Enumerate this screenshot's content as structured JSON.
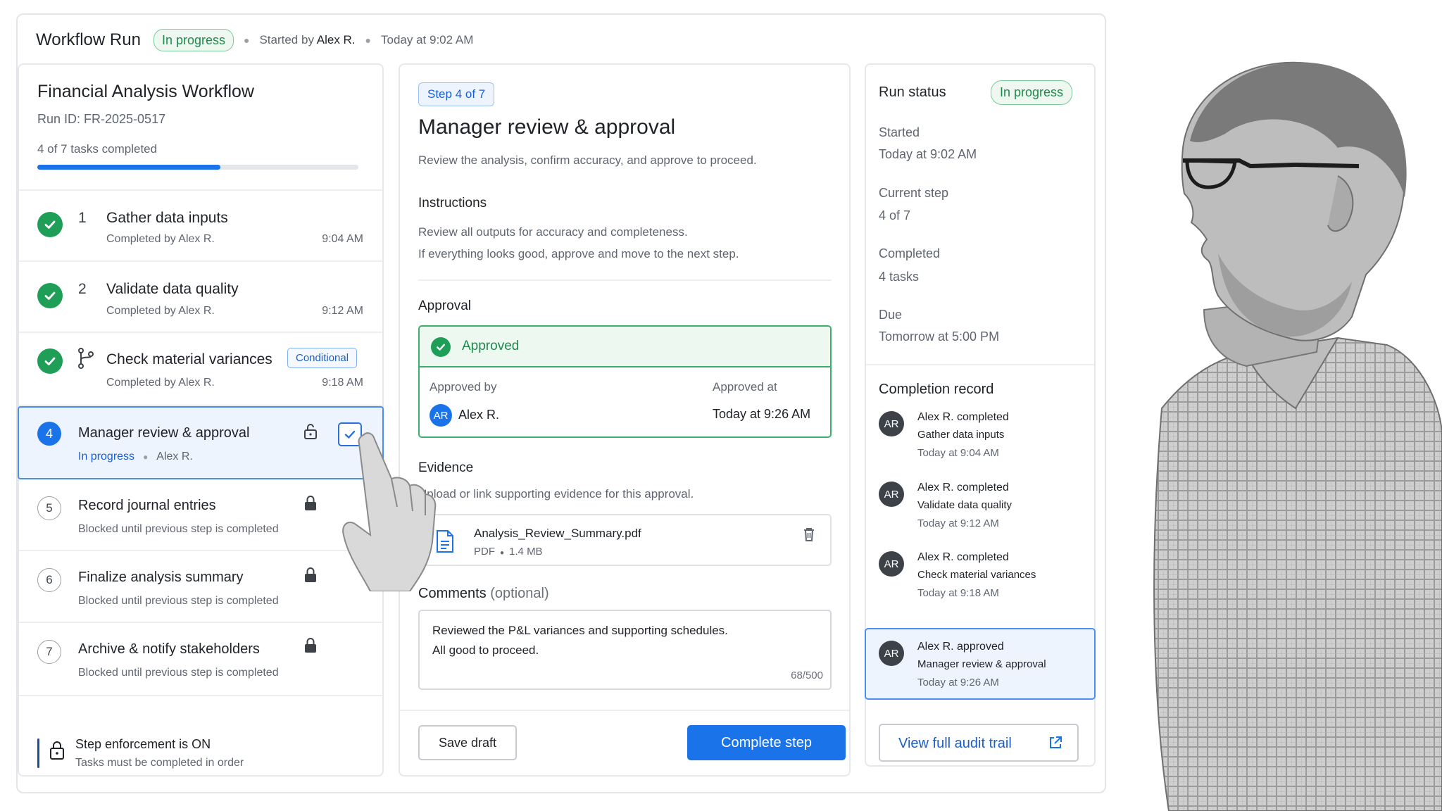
{
  "header": {
    "title": "Workflow Run",
    "status": "In progress",
    "started_by_prefix": "Started by",
    "started_by_name": "Alex R.",
    "started_time": "Today at 9:02 AM"
  },
  "workflow": {
    "title": "Financial Analysis Workflow",
    "run_id": "Run ID: FR-2025-0517",
    "progress_label": "4 of 7 tasks completed",
    "progress_fraction": 0.571
  },
  "steps": [
    {
      "num": "1",
      "title": "Gather data inputs",
      "sub": "Completed by Alex R.",
      "time": "9:04 AM",
      "state": "completed"
    },
    {
      "num": "2",
      "title": "Validate data quality",
      "sub": "Completed by Alex R.",
      "time": "9:12 AM",
      "state": "completed"
    },
    {
      "num": "3",
      "title": "Check material variances",
      "sub": "Completed by Alex R.",
      "time": "9:18 AM",
      "state": "completed",
      "badge": "Conditional"
    },
    {
      "num": "4",
      "title": "Manager review & approval",
      "status": "In progress",
      "assignee": "Alex R.",
      "state": "active"
    },
    {
      "num": "5",
      "title": "Record journal entries",
      "sub": "Blocked until previous step is completed",
      "state": "locked"
    },
    {
      "num": "6",
      "title": "Finalize analysis summary",
      "sub": "Blocked until previous step is completed",
      "state": "locked"
    },
    {
      "num": "7",
      "title": "Archive & notify stakeholders",
      "sub": "Blocked until previous step is completed",
      "state": "locked"
    }
  ],
  "enforcement": {
    "title": "Step enforcement is ON",
    "subtitle": "Tasks must be completed in order"
  },
  "detail": {
    "step_pill": "Step 4 of 7",
    "title": "Manager review & approval",
    "description": "Review the analysis, confirm accuracy, and approve to proceed.",
    "instructions_label": "Instructions",
    "instructions": [
      "Review all outputs for accuracy and completeness.",
      "If everything looks good, approve and move to the next step."
    ],
    "approval_label": "Approval",
    "approval_status": "Approved",
    "approved_by_label": "Approved by",
    "approved_by_initials": "AR",
    "approved_by_name": "Alex R.",
    "approved_at_label": "Approved at",
    "approved_at_value": "Today at 9:26 AM",
    "evidence_label": "Evidence",
    "evidence_sub": "Upload or link supporting evidence for this approval.",
    "file_name": "Analysis_Review_Summary.pdf",
    "file_type": "PDF",
    "file_size": "1.4 MB",
    "comments_label": "Comments",
    "comments_optional": "(optional)",
    "comment_lines": [
      "Reviewed the P&L variances and supporting schedules.",
      "All good to proceed."
    ],
    "char_count": "68/500",
    "save_draft": "Save draft",
    "complete_step": "Complete step"
  },
  "run_status": {
    "title": "Run status",
    "status": "In progress",
    "started_label": "Started",
    "started_value": "Today at 9:02 AM",
    "current_step_label": "Current step",
    "current_step_value": "4 of 7",
    "completed_label": "Completed",
    "completed_value": "4 tasks",
    "due_label": "Due",
    "due_value": "Tomorrow at 5:00 PM"
  },
  "completion_record": {
    "title": "Completion record",
    "items": [
      {
        "initials": "AR",
        "actor": "Alex R.",
        "action": "completed",
        "task": "Gather data inputs",
        "time": "Today at 9:04 AM"
      },
      {
        "initials": "AR",
        "actor": "Alex R.",
        "action": "completed",
        "task": "Validate data quality",
        "time": "Today at 9:12 AM"
      },
      {
        "initials": "AR",
        "actor": "Alex R.",
        "action": "completed",
        "task": "Check material variances",
        "time": "Today at 9:18 AM"
      },
      {
        "initials": "AR",
        "actor": "Alex R.",
        "action": "approved",
        "task": "Manager review & approval",
        "time": "Today at 9:26 AM"
      }
    ],
    "audit_button": "View full audit trail"
  },
  "colors": {
    "accent": "#1a73e8",
    "success": "#1e9e57",
    "muted": "#5f6670"
  }
}
